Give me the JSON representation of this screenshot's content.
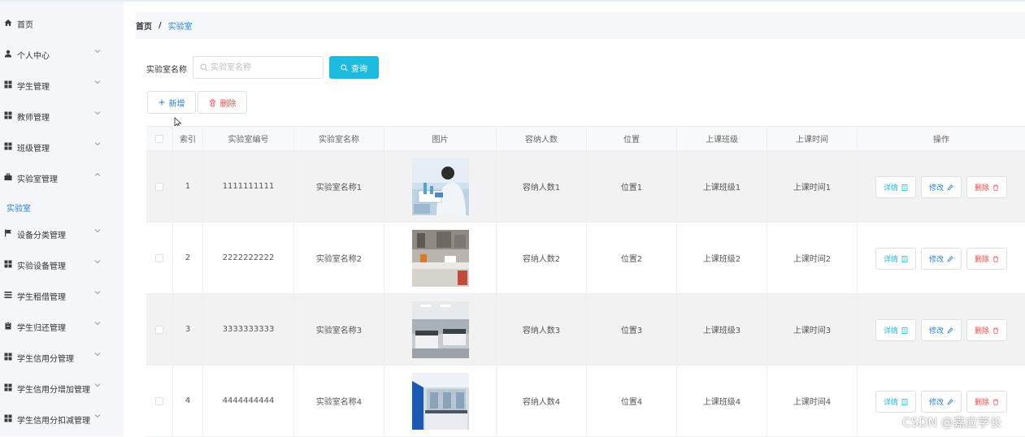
{
  "sidebar": {
    "items": [
      {
        "label": "首页",
        "icon": "home-icon",
        "has_arrow": false
      },
      {
        "label": "个人中心",
        "icon": "user-icon",
        "has_arrow": true
      },
      {
        "label": "学生管理",
        "icon": "grid-icon",
        "has_arrow": true
      },
      {
        "label": "教师管理",
        "icon": "grid-icon",
        "has_arrow": true
      },
      {
        "label": "班级管理",
        "icon": "grid-icon",
        "has_arrow": true
      },
      {
        "label": "实验室管理",
        "icon": "briefcase-icon",
        "has_arrow": true
      },
      {
        "label": "设备分类管理",
        "icon": "flag-icon",
        "has_arrow": true
      },
      {
        "label": "实验设备管理",
        "icon": "grid-icon",
        "has_arrow": true
      },
      {
        "label": "学生租借管理",
        "icon": "list-icon",
        "has_arrow": true
      },
      {
        "label": "学生归还管理",
        "icon": "clipboard-icon",
        "has_arrow": true
      },
      {
        "label": "学生信用分管理",
        "icon": "grid-icon",
        "has_arrow": true
      },
      {
        "label": "学生信用分增加管理",
        "icon": "grid-icon",
        "has_arrow": true
      },
      {
        "label": "学生信用分扣减管理",
        "icon": "grid-icon",
        "has_arrow": true
      }
    ],
    "sub_item": "实验室"
  },
  "breadcrumb": {
    "home": "首页",
    "separator": "/",
    "current": "实验室"
  },
  "search": {
    "label": "实验室名称",
    "placeholder": "实验室名称",
    "value": "",
    "query_label": "查询"
  },
  "toolbar": {
    "add_label": "新增",
    "delete_label": "删除"
  },
  "table": {
    "headers": [
      "索引",
      "实验室编号",
      "实验室名称",
      "图片",
      "容纳人数",
      "位置",
      "上课班级",
      "上课时间",
      "操作"
    ],
    "rows": [
      {
        "index": "1",
        "number": "1111111111",
        "name": "实验室名称1",
        "image": "lab-photo-researcher",
        "capacity": "容纳人数1",
        "location": "位置1",
        "class": "上课班级1",
        "time": "上课时间1"
      },
      {
        "index": "2",
        "number": "2222222222",
        "name": "实验室名称2",
        "image": "lab-photo-bench",
        "capacity": "容纳人数2",
        "location": "位置2",
        "class": "上课班级2",
        "time": "上课时间2"
      },
      {
        "index": "3",
        "number": "3333333333",
        "name": "实验室名称3",
        "image": "lab-photo-room",
        "capacity": "容纳人数3",
        "location": "位置3",
        "class": "上课班级3",
        "time": "上课时间3"
      },
      {
        "index": "4",
        "number": "4444444444",
        "name": "实验室名称4",
        "image": "lab-photo-blue",
        "capacity": "容纳人数4",
        "location": "位置4",
        "class": "上课班级4",
        "time": "上课时间4"
      }
    ],
    "actions": {
      "detail": "详情",
      "edit": "修改",
      "remove": "删除"
    }
  },
  "watermark": "CSDN @嘉应学长",
  "colors": {
    "accent": "#1ebbe0",
    "link": "#2a7fd4",
    "danger": "#f04b4b",
    "sidebar_bg": "#f4f6fa"
  }
}
